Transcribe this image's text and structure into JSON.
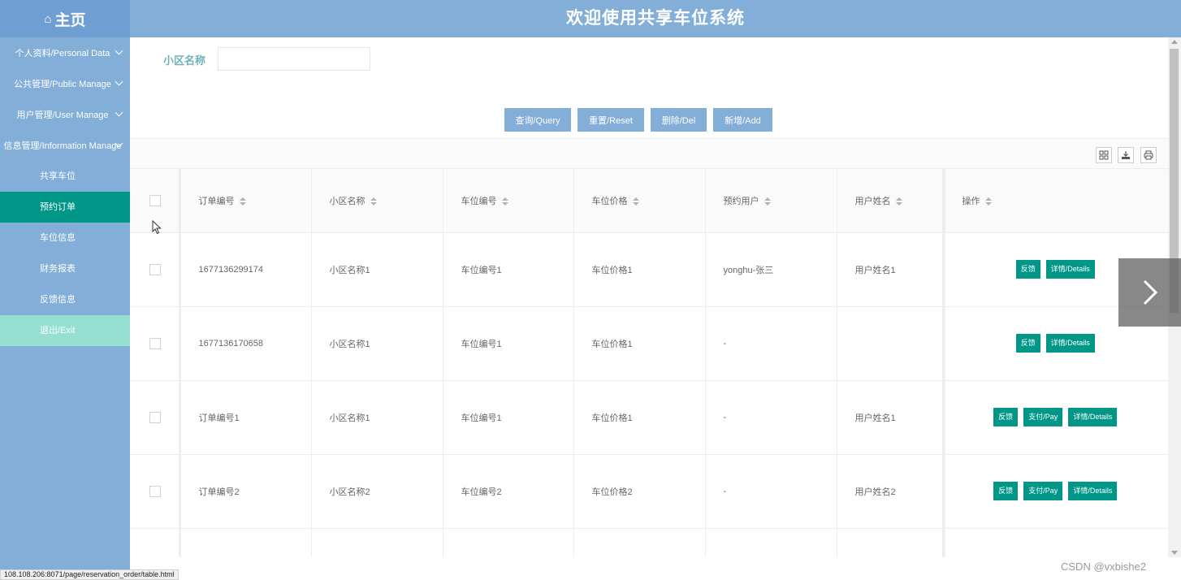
{
  "header": {
    "home_label": "主页",
    "home_icon": "home-icon",
    "title": "欢迎使用共享车位系统"
  },
  "sidebar": {
    "groups": [
      {
        "label": "个人资料/Personal Data"
      },
      {
        "label": "公共管理/Public Manage"
      },
      {
        "label": "用户管理/User Manage"
      },
      {
        "label": "信息管理/Information Manage"
      }
    ],
    "sub_items": [
      {
        "label": "共享车位"
      },
      {
        "label": "预约订单",
        "active": true
      },
      {
        "label": "车位信息"
      },
      {
        "label": "财务报表"
      },
      {
        "label": "反馈信息"
      }
    ],
    "exit_label": "退出/Exit"
  },
  "search": {
    "label": "小区名称",
    "value": "",
    "placeholder": ""
  },
  "buttons": {
    "query": "查询/Query",
    "reset": "重置/Reset",
    "delete": "删除/Del",
    "add": "新增/Add"
  },
  "toolbar_icons": [
    "columns-icon",
    "export-icon",
    "print-icon"
  ],
  "table": {
    "columns": [
      "订单编号",
      "小区名称",
      "车位编号",
      "车位价格",
      "预约用户",
      "用户姓名",
      "操作"
    ],
    "rows": [
      {
        "order_no": "1677136299174",
        "community": "小区名称1",
        "space_no": "车位编号1",
        "price": "车位价格1",
        "reserve_user": "yonghu-张三",
        "user_name": "用户姓名1",
        "actions": [
          "反馈",
          "详情/Details"
        ]
      },
      {
        "order_no": "1677136170658",
        "community": "小区名称1",
        "space_no": "车位编号1",
        "price": "车位价格1",
        "reserve_user": "-",
        "user_name": "",
        "actions": [
          "反馈",
          "详情/Details"
        ]
      },
      {
        "order_no": "订单编号1",
        "community": "小区名称1",
        "space_no": "车位编号1",
        "price": "车位价格1",
        "reserve_user": "-",
        "user_name": "用户姓名1",
        "actions": [
          "反馈",
          "支付/Pay",
          "详情/Details"
        ]
      },
      {
        "order_no": "订单编号2",
        "community": "小区名称2",
        "space_no": "车位编号2",
        "price": "车位价格2",
        "reserve_user": "-",
        "user_name": "用户姓名2",
        "actions": [
          "反馈",
          "支付/Pay",
          "详情/Details"
        ]
      }
    ]
  },
  "status_url": "108.108.206:8071/page/reservation_order/table.html",
  "watermark": "CSDN @vxbishe2",
  "colors": {
    "header_bg": "#82aed8",
    "sidebar_bg": "#82aed8",
    "active_item": "#009688",
    "exit_bg": "#96e0d2",
    "action_button": "#009688",
    "primary_button": "#82aed8"
  }
}
